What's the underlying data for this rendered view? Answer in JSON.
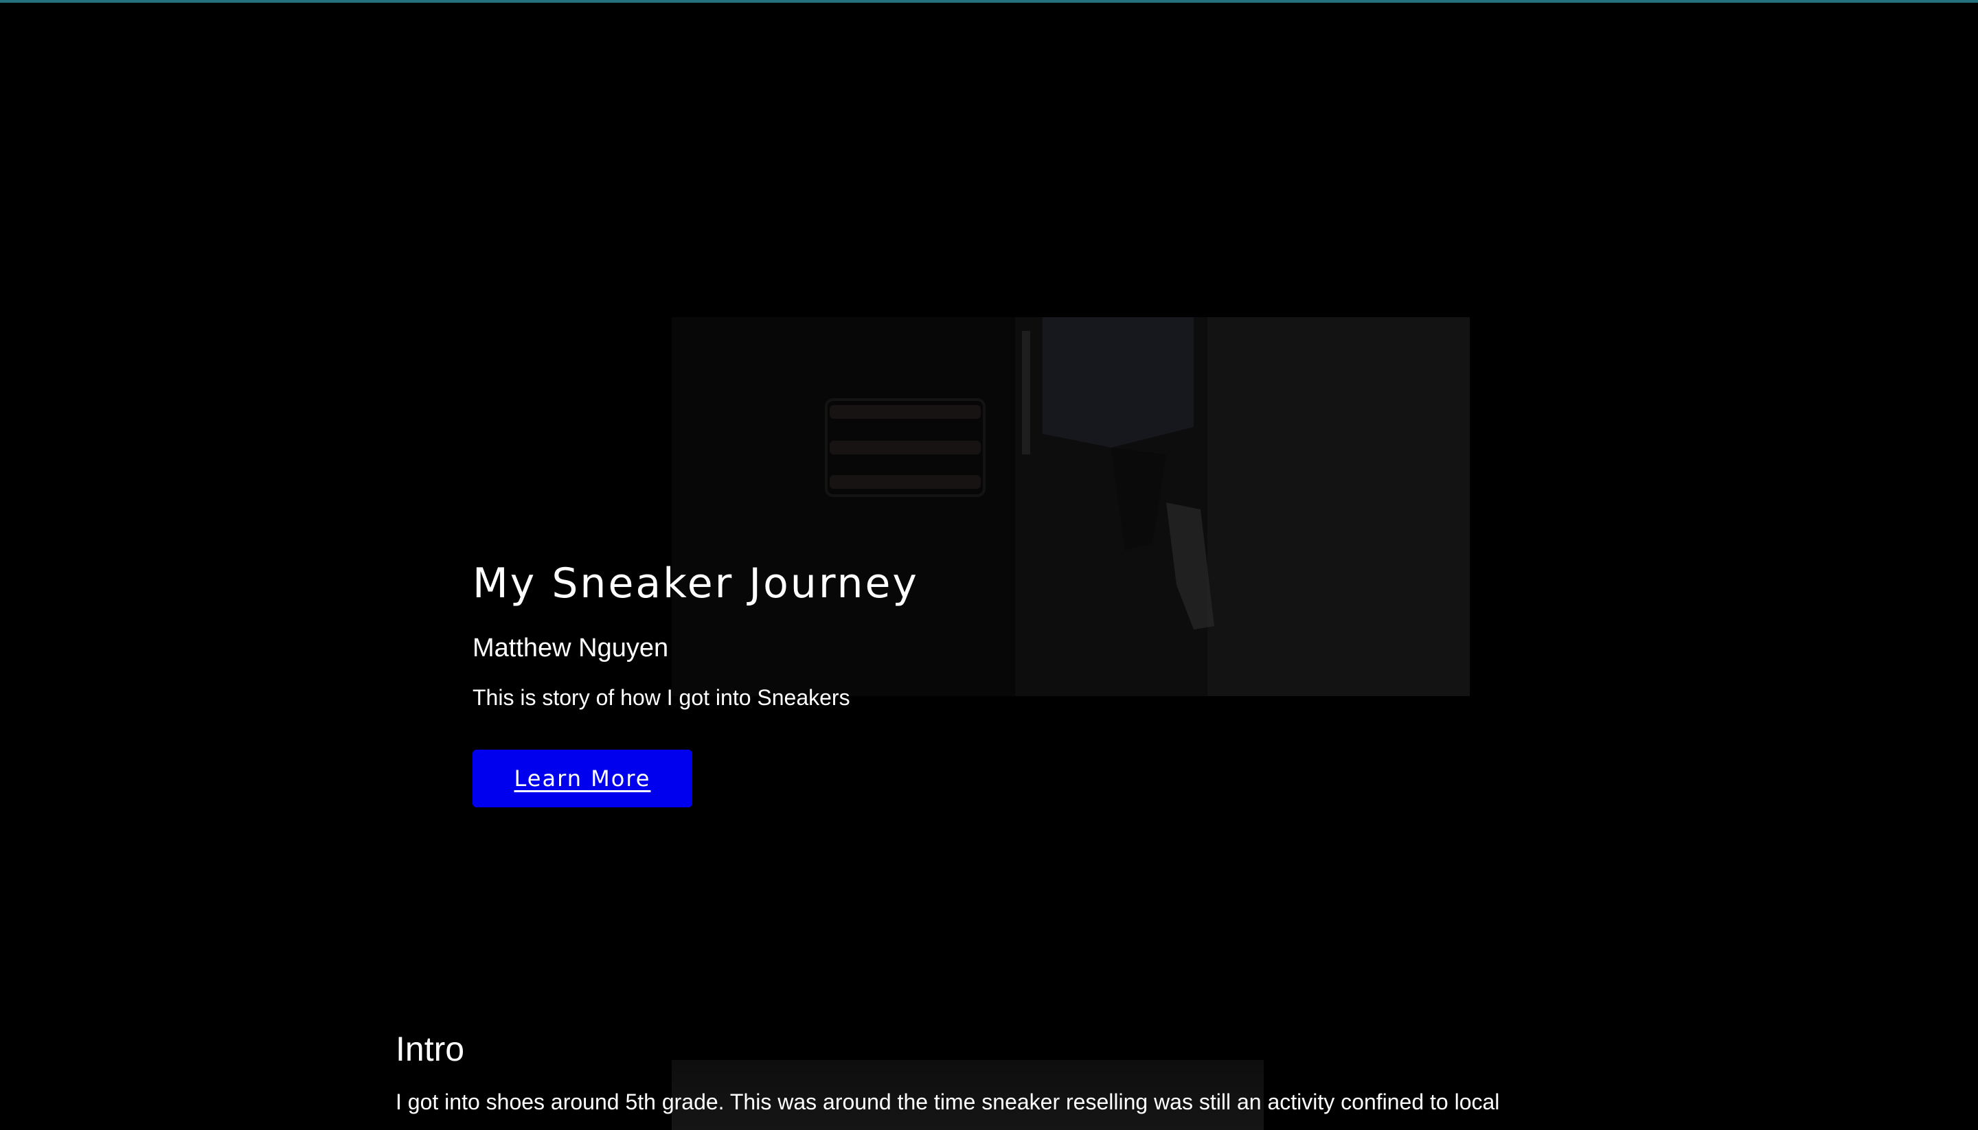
{
  "hero": {
    "title": "My Sneaker Journey",
    "author": "Matthew Nguyen",
    "description": "This is story of how I got into Sneakers",
    "button_label": "Learn More"
  },
  "intro": {
    "heading": "Intro",
    "text": "I got into shoes around 5th grade. This was around the time sneaker reselling was still an activity confined to local"
  },
  "colors": {
    "background": "#000000",
    "accent_bar": "#24707c",
    "button": "#0000ee",
    "text": "#ffffff"
  }
}
